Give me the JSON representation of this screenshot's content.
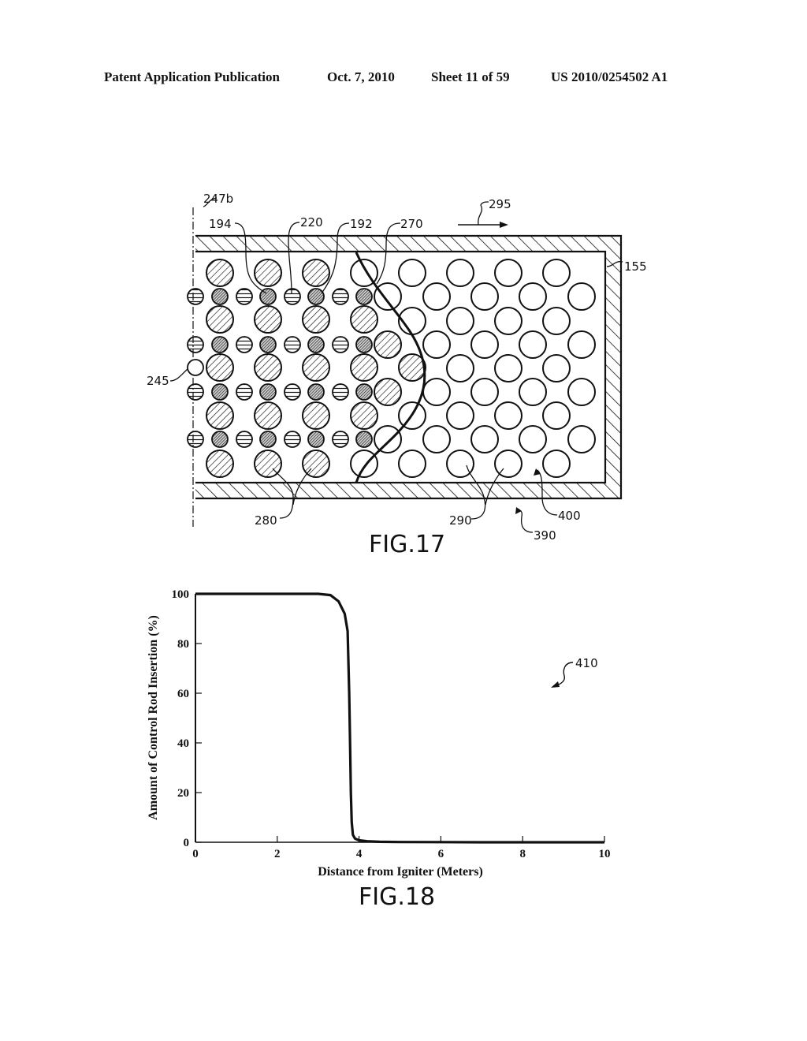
{
  "header": {
    "publication": "Patent Application Publication",
    "date": "Oct. 7, 2010",
    "sheet": "Sheet 11 of 59",
    "number": "US 2010/0254502 A1"
  },
  "fig17": {
    "caption": "FIG.17",
    "labels": {
      "centerline": "247b",
      "l194": "194",
      "l220": "220",
      "l192": "192",
      "l270": "270",
      "l295": "295",
      "l155": "155",
      "l245": "245",
      "l280": "280",
      "l290": "290",
      "l400": "400",
      "l390": "390"
    }
  },
  "fig18": {
    "caption": "FIG.18",
    "ref_label": "410"
  },
  "chart_data": {
    "type": "line",
    "title": "",
    "xlabel": "Distance from Igniter  (Meters)",
    "ylabel": "Amount of Control Rod Insertion  (%)",
    "xlim": [
      0,
      10
    ],
    "ylim": [
      0,
      100
    ],
    "xticks": [
      "0",
      "2",
      "4",
      "6",
      "8",
      "10"
    ],
    "yticks": [
      "0",
      "20",
      "40",
      "60",
      "80",
      "100"
    ],
    "grid": false,
    "series": [
      {
        "name": "control rod insertion",
        "x": [
          0,
          1,
          2,
          3,
          3.3,
          3.5,
          3.65,
          3.72,
          3.76,
          3.78,
          3.8,
          3.82,
          3.85,
          3.9,
          4.0,
          4.2,
          4.5,
          5,
          6,
          7,
          8,
          9,
          10
        ],
        "y": [
          100,
          100,
          100,
          100,
          99.5,
          97,
          92,
          85,
          60,
          40,
          20,
          8,
          3,
          1.5,
          0.8,
          0.4,
          0.2,
          0.1,
          0.05,
          0,
          0,
          0,
          0
        ]
      }
    ]
  }
}
